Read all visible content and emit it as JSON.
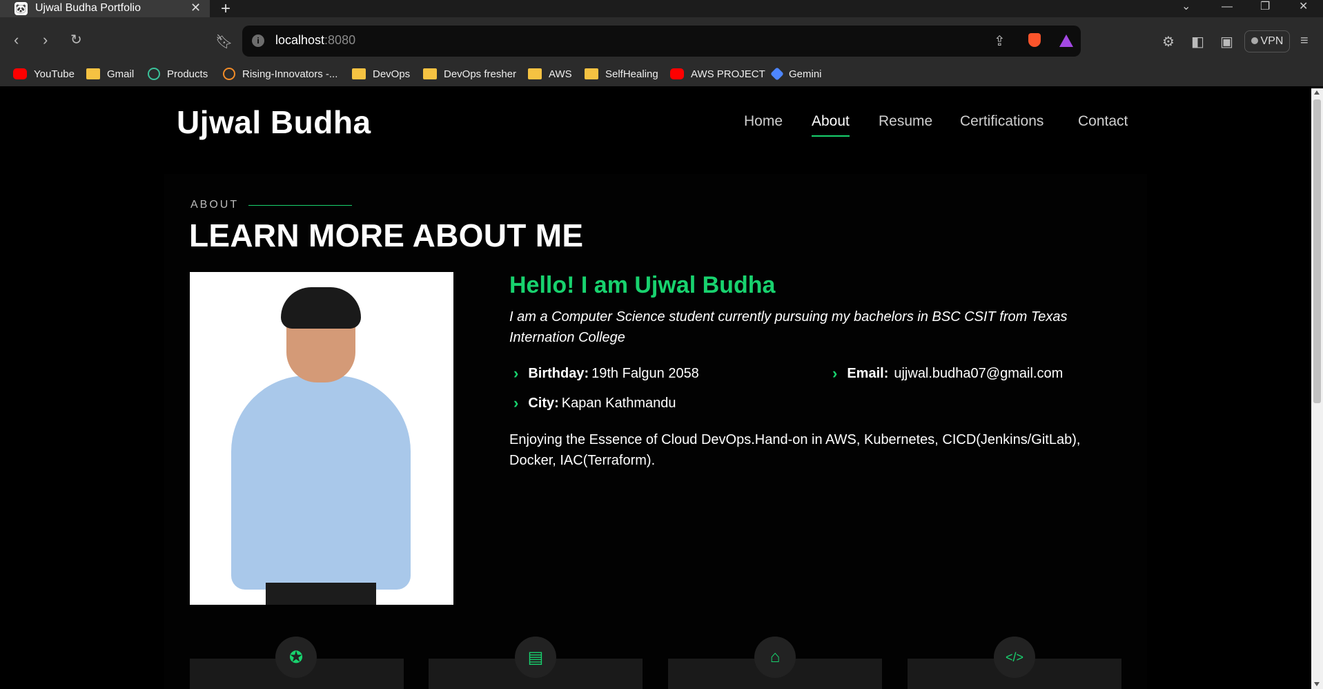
{
  "browser": {
    "tab_title": "Ujwal Budha Portfolio",
    "url_host": "localhost",
    "url_port": ":8080",
    "vpn_label": "VPN",
    "bookmarks": [
      {
        "label": "YouTube",
        "icon": "youtube-icon"
      },
      {
        "label": "Gmail",
        "icon": "folder-icon"
      },
      {
        "label": "Products",
        "icon": "products-icon"
      },
      {
        "label": "Rising-Innovators -...",
        "icon": "cloud-icon"
      },
      {
        "label": "DevOps",
        "icon": "folder-icon"
      },
      {
        "label": "DevOps fresher",
        "icon": "folder-icon"
      },
      {
        "label": "AWS",
        "icon": "folder-icon"
      },
      {
        "label": "SelfHealing",
        "icon": "folder-icon"
      },
      {
        "label": "AWS PROJECT",
        "icon": "youtube-icon"
      },
      {
        "label": "Gemini",
        "icon": "gemini-icon"
      }
    ]
  },
  "site": {
    "logo": "Ujwal Budha",
    "accent_color": "#18d26e",
    "nav": [
      {
        "label": "Home",
        "active": false
      },
      {
        "label": "About",
        "active": true
      },
      {
        "label": "Resume",
        "active": false
      },
      {
        "label": "Certifications",
        "active": false
      },
      {
        "label": "Contact",
        "active": false
      }
    ]
  },
  "about": {
    "section_label": "ABOUT",
    "title": "LEARN MORE ABOUT ME",
    "hello": "Hello! I am Ujwal Budha",
    "intro": "I am a Computer Science student currently pursuing my bachelors in BSC CSIT from Texas Internation College",
    "birthday_label": "Birthday:",
    "birthday_value": "19th Falgun 2058",
    "email_label": "Email:",
    "email_value": "ujjwal.budha07@gmail.com",
    "city_label": "City:",
    "city_value": "Kapan Kathmandu",
    "description": "Enjoying the Essence of Cloud DevOps.Hand-on in AWS, Kubernetes, CICD(Jenkins/GitLab), Docker, IAC(Terraform)."
  },
  "cards": [
    {
      "icon": "award-icon"
    },
    {
      "icon": "certificate-icon"
    },
    {
      "icon": "institution-icon"
    },
    {
      "icon": "code-icon"
    }
  ]
}
